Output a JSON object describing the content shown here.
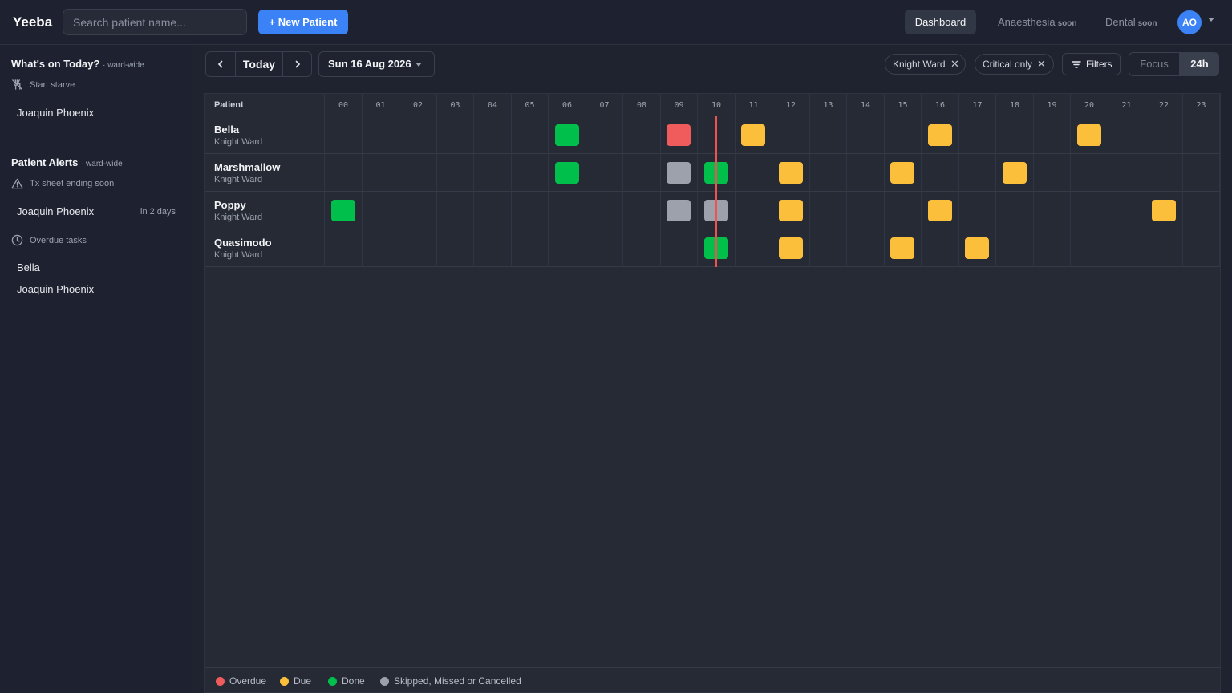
{
  "app": {
    "brand": "Yeeba"
  },
  "header": {
    "search_placeholder": "Search patient name...",
    "new_patient_label": "+ New Patient",
    "nav": [
      {
        "label": "Dashboard",
        "badge": ""
      },
      {
        "label": "Anaesthesia",
        "badge": "soon"
      },
      {
        "label": "Dental",
        "badge": "soon"
      }
    ],
    "avatar_initials": "AO"
  },
  "sidebar": {
    "today": {
      "title": "What's on Today?",
      "scope": "· ward-wide",
      "groups": [
        {
          "heading": "Start starve",
          "icon": "no-food-icon",
          "items": [
            {
              "name": "Joaquin Phoenix",
              "note": ""
            }
          ]
        }
      ]
    },
    "alerts": {
      "title": "Patient Alerts",
      "scope": "· ward-wide",
      "groups": [
        {
          "heading": "Tx sheet ending soon",
          "icon": "warning-icon",
          "items": [
            {
              "name": "Joaquin Phoenix",
              "note": "in 2 days"
            }
          ]
        },
        {
          "heading": "Overdue tasks",
          "icon": "clock-icon",
          "items": [
            {
              "name": "Bella",
              "note": ""
            },
            {
              "name": "Joaquin Phoenix",
              "note": ""
            }
          ]
        }
      ]
    }
  },
  "toolbar": {
    "today_label": "Today",
    "date_label": "Sun 16 Aug 2026",
    "chips": [
      {
        "label": "Knight Ward"
      },
      {
        "label": "Critical only"
      }
    ],
    "filters_label": "Filters",
    "view_modes": [
      {
        "label": "Focus",
        "active": false
      },
      {
        "label": "24h",
        "active": true
      }
    ]
  },
  "grid": {
    "patient_header": "Patient",
    "hours": [
      "00",
      "01",
      "02",
      "03",
      "04",
      "05",
      "06",
      "07",
      "08",
      "09",
      "10",
      "11",
      "12",
      "13",
      "14",
      "15",
      "16",
      "17",
      "18",
      "19",
      "20",
      "21",
      "22",
      "23"
    ],
    "now_hour": 10.5,
    "patients": [
      {
        "name": "Bella",
        "ward": "Knight Ward",
        "tasks": [
          {
            "hour": 6,
            "status": "done"
          },
          {
            "hour": 9,
            "status": "overdue"
          },
          {
            "hour": 11,
            "status": "due"
          },
          {
            "hour": 16,
            "status": "due"
          },
          {
            "hour": 20,
            "status": "due"
          }
        ]
      },
      {
        "name": "Marshmallow",
        "ward": "Knight Ward",
        "tasks": [
          {
            "hour": 6,
            "status": "done"
          },
          {
            "hour": 9,
            "status": "skipped"
          },
          {
            "hour": 10,
            "status": "done"
          },
          {
            "hour": 12,
            "status": "due"
          },
          {
            "hour": 15,
            "status": "due"
          },
          {
            "hour": 18,
            "status": "due"
          }
        ]
      },
      {
        "name": "Poppy",
        "ward": "Knight Ward",
        "tasks": [
          {
            "hour": 0,
            "status": "done"
          },
          {
            "hour": 9,
            "status": "skipped"
          },
          {
            "hour": 10,
            "status": "skipped"
          },
          {
            "hour": 12,
            "status": "due"
          },
          {
            "hour": 16,
            "status": "due"
          },
          {
            "hour": 22,
            "status": "due"
          }
        ]
      },
      {
        "name": "Quasimodo",
        "ward": "Knight Ward",
        "tasks": [
          {
            "hour": 10,
            "status": "done"
          },
          {
            "hour": 12,
            "status": "due"
          },
          {
            "hour": 15,
            "status": "due"
          },
          {
            "hour": 17,
            "status": "due"
          }
        ]
      }
    ]
  },
  "legend": [
    {
      "key": "overdue",
      "label": "Overdue"
    },
    {
      "key": "due",
      "label": "Due"
    },
    {
      "key": "done",
      "label": "Done"
    },
    {
      "key": "skipped",
      "label": "Skipped, Missed or Cancelled"
    }
  ],
  "colors": {
    "overdue": "#f05b5b",
    "due": "#fbbf3c",
    "done": "#00c04b",
    "skipped": "#9ca1ab",
    "accent": "#3b82f6",
    "now_line": "#f05252"
  }
}
